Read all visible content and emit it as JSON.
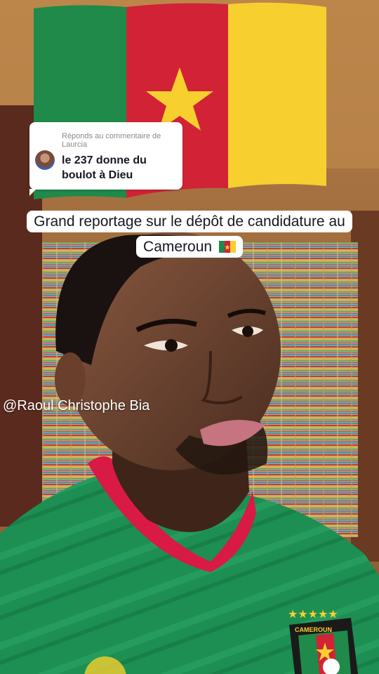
{
  "comment_reply": {
    "header": "Réponds au commentaire de Laurcia",
    "text": "le 237 donne du boulot à Dieu"
  },
  "caption": {
    "line1": "Grand reportage sur le dépôt de candidature au",
    "line2": "Cameroun"
  },
  "mention": "@Raoul Christophe Bia",
  "jersey_badge_text": "CAMEROUN",
  "colors": {
    "flag_green": "#1f8a4a",
    "flag_red": "#d22236",
    "flag_yellow": "#f7cf2f",
    "jersey_green": "#1d8f53",
    "collar_red": "#d81a45"
  }
}
